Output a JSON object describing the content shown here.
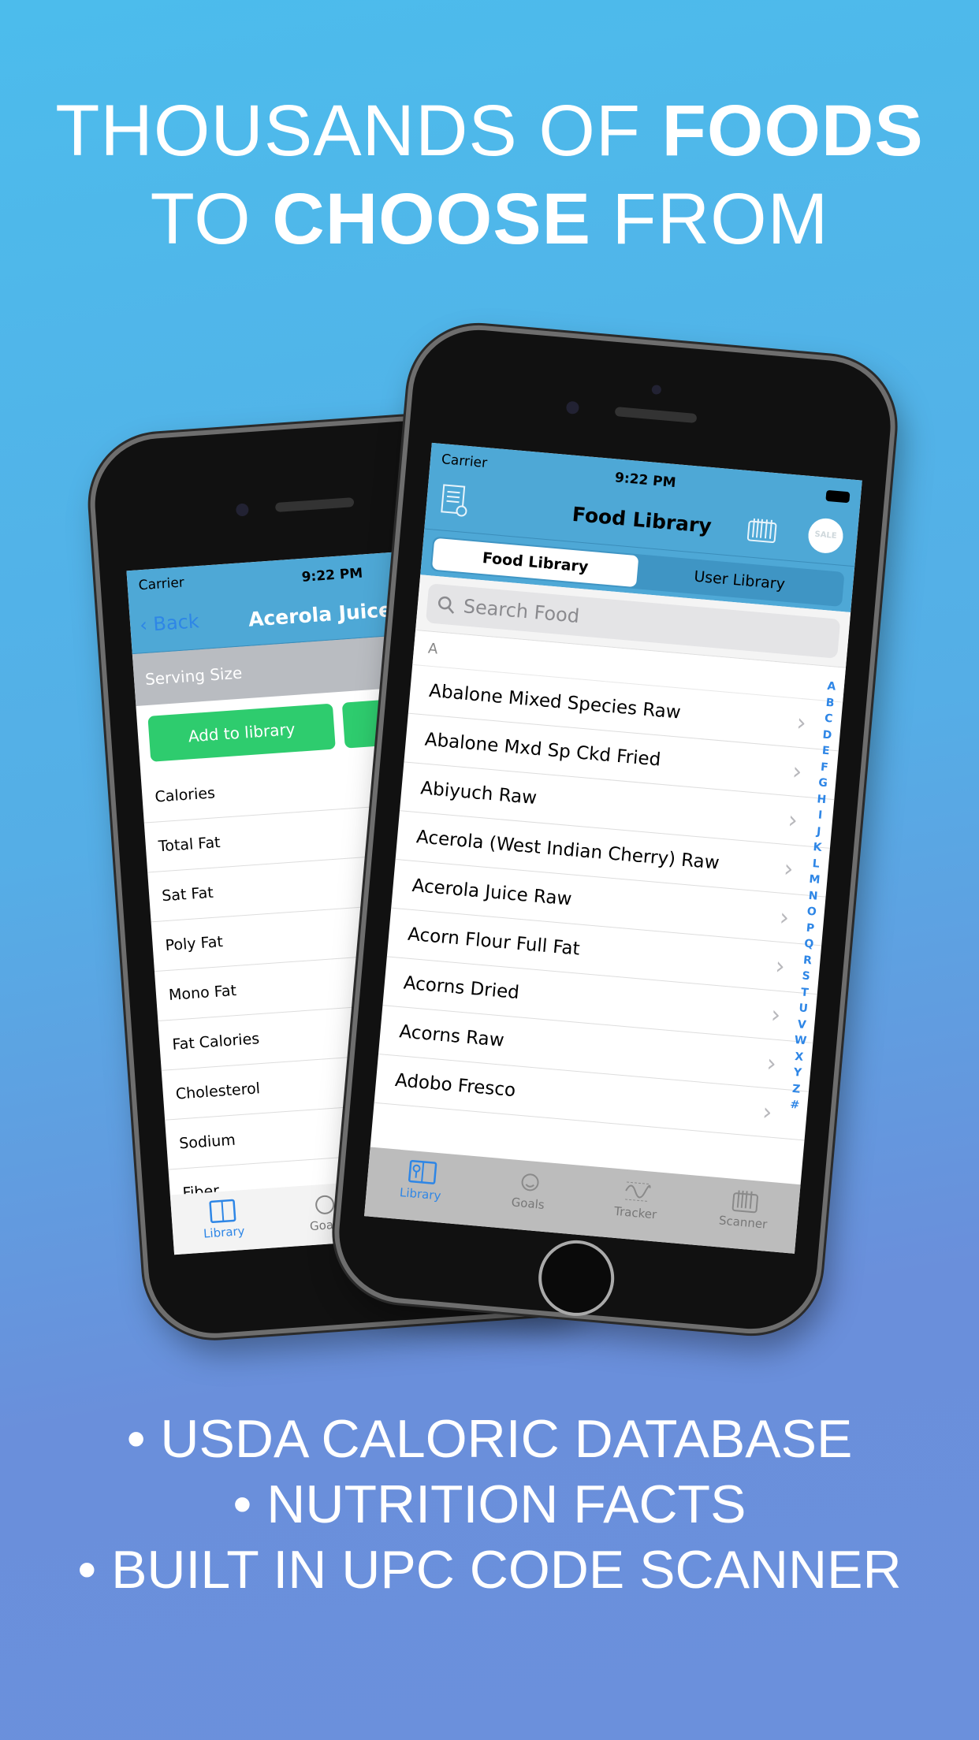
{
  "headline": {
    "line1_light": "THOUSANDS OF ",
    "line1_bold": "FOODS",
    "line2_light1": "TO ",
    "line2_bold": "CHOOSE",
    "line2_light2": " FROM"
  },
  "bullets": [
    "• USDA CALORIC DATABASE",
    "• NUTRITION FACTS",
    "• BUILT IN UPC CODE SCANNER"
  ],
  "colors": {
    "accent_blue": "#4ea8d6",
    "green_button": "#2ecc6e",
    "tab_active": "#2e86e6"
  },
  "back_phone": {
    "status": {
      "carrier": "Carrier",
      "time": "9:22 PM"
    },
    "nav": {
      "back_label": "Back",
      "title": "Acerola Juice Raw"
    },
    "serving_size_label": "Serving Size",
    "buttons": [
      "Add to library",
      ""
    ],
    "rows": [
      "Calories",
      "Total Fat",
      "Sat Fat",
      "Poly Fat",
      "Mono Fat",
      "Fat Calories",
      "Cholesterol",
      "Sodium",
      "Fiber"
    ],
    "tabs": [
      "Library",
      "Goals"
    ]
  },
  "front_phone": {
    "status": {
      "carrier": "Carrier",
      "time": "9:22 PM"
    },
    "nav": {
      "title": "Food Library",
      "icons": [
        "list-add-icon",
        "barcode-icon",
        "sale-badge-icon"
      ],
      "sale_label": "SALE"
    },
    "segments": [
      {
        "label": "Food Library",
        "selected": true
      },
      {
        "label": "User Library",
        "selected": false
      }
    ],
    "search": {
      "placeholder": "Search Food"
    },
    "section": "A",
    "rows": [
      "Abalone Mixed Species Raw",
      "Abalone Mxd Sp Ckd Fried",
      "Abiyuch Raw",
      "Acerola (West Indian Cherry) Raw",
      "Acerola Juice Raw",
      "Acorn Flour Full Fat",
      "Acorns Dried",
      "Acorns Raw",
      "Adobo Fresco"
    ],
    "index": [
      "A",
      "B",
      "C",
      "D",
      "E",
      "F",
      "G",
      "H",
      "I",
      "J",
      "K",
      "L",
      "M",
      "N",
      "O",
      "P",
      "Q",
      "R",
      "S",
      "T",
      "U",
      "V",
      "W",
      "X",
      "Y",
      "Z",
      "#"
    ],
    "tabs": [
      {
        "label": "Library",
        "active": true
      },
      {
        "label": "Goals",
        "active": false
      },
      {
        "label": "Tracker",
        "active": false
      },
      {
        "label": "Scanner",
        "active": false
      }
    ]
  }
}
